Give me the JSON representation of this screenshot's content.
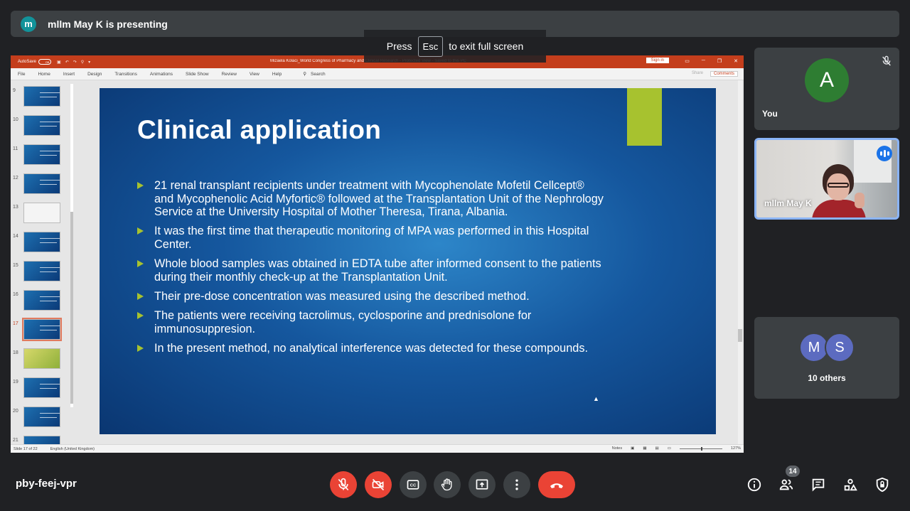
{
  "presenting": {
    "avatar_letter": "m",
    "text": "mllm May K is presenting"
  },
  "fullscreen_hint": {
    "press": "Press",
    "key": "Esc",
    "rest": "to exit full screen"
  },
  "powerpoint": {
    "autosave_label": "AutoSave",
    "autosave_state": "Off",
    "doc_title": "Mizaela Kolaci_World Congress of  Pharmacy and Clinical Research  -  Protected View  -  Saved to this PC",
    "sign_in": "Sign in",
    "ribbon_tabs": [
      "File",
      "Home",
      "Insert",
      "Design",
      "Transitions",
      "Animations",
      "Slide Show",
      "Review",
      "View",
      "Help"
    ],
    "search": "Search",
    "share": "Share",
    "comments": "Comments",
    "thumb_numbers": [
      "9",
      "10",
      "11",
      "12",
      "13",
      "14",
      "15",
      "16",
      "17",
      "18",
      "19",
      "20",
      "21"
    ],
    "selected_slide": "17",
    "status_slide": "Slide 17 of 22",
    "status_lang": "English (United Kingdom)",
    "status_notes": "Notes",
    "zoom": "127%"
  },
  "slide": {
    "title": "Clinical application",
    "bullets": [
      "21 renal transplant recipients under treatment with Mycophenolate Mofetil Cellcept® and Mycophenolic Acid Myfortic® followed at the Transplantation Unit of the Nephrology Service at the University Hospital of Mother Theresa, Tirana, Albania.",
      "It was the first time that therapeutic monitoring of MPA was performed in this Hospital Center.",
      "Whole blood samples was obtained in EDTA tube after informed consent to the patients during their monthly check-up at the Transplantation Unit.",
      "Their pre-dose concentration was measured using the described method.",
      "The patients were receiving tacrolimus, cyclosporine and prednisolone for immunosuppresion.",
      "In the present method, no analytical interference was detected for these compounds."
    ]
  },
  "tiles": {
    "you": {
      "letter": "A",
      "name": "You",
      "color": "#2e7d32"
    },
    "presenter": {
      "name": "mllm May K"
    },
    "others": {
      "letters": [
        "M",
        "S"
      ],
      "colors": [
        "#5c6bc0",
        "#5c6bc0"
      ],
      "label": "10 others"
    }
  },
  "bottom": {
    "meeting_code": "pby-feej-vpr",
    "participants_count": "14"
  },
  "colors": {
    "accent": "#1a73e8",
    "danger": "#ea4335",
    "slide_accent": "#a7c22f"
  }
}
